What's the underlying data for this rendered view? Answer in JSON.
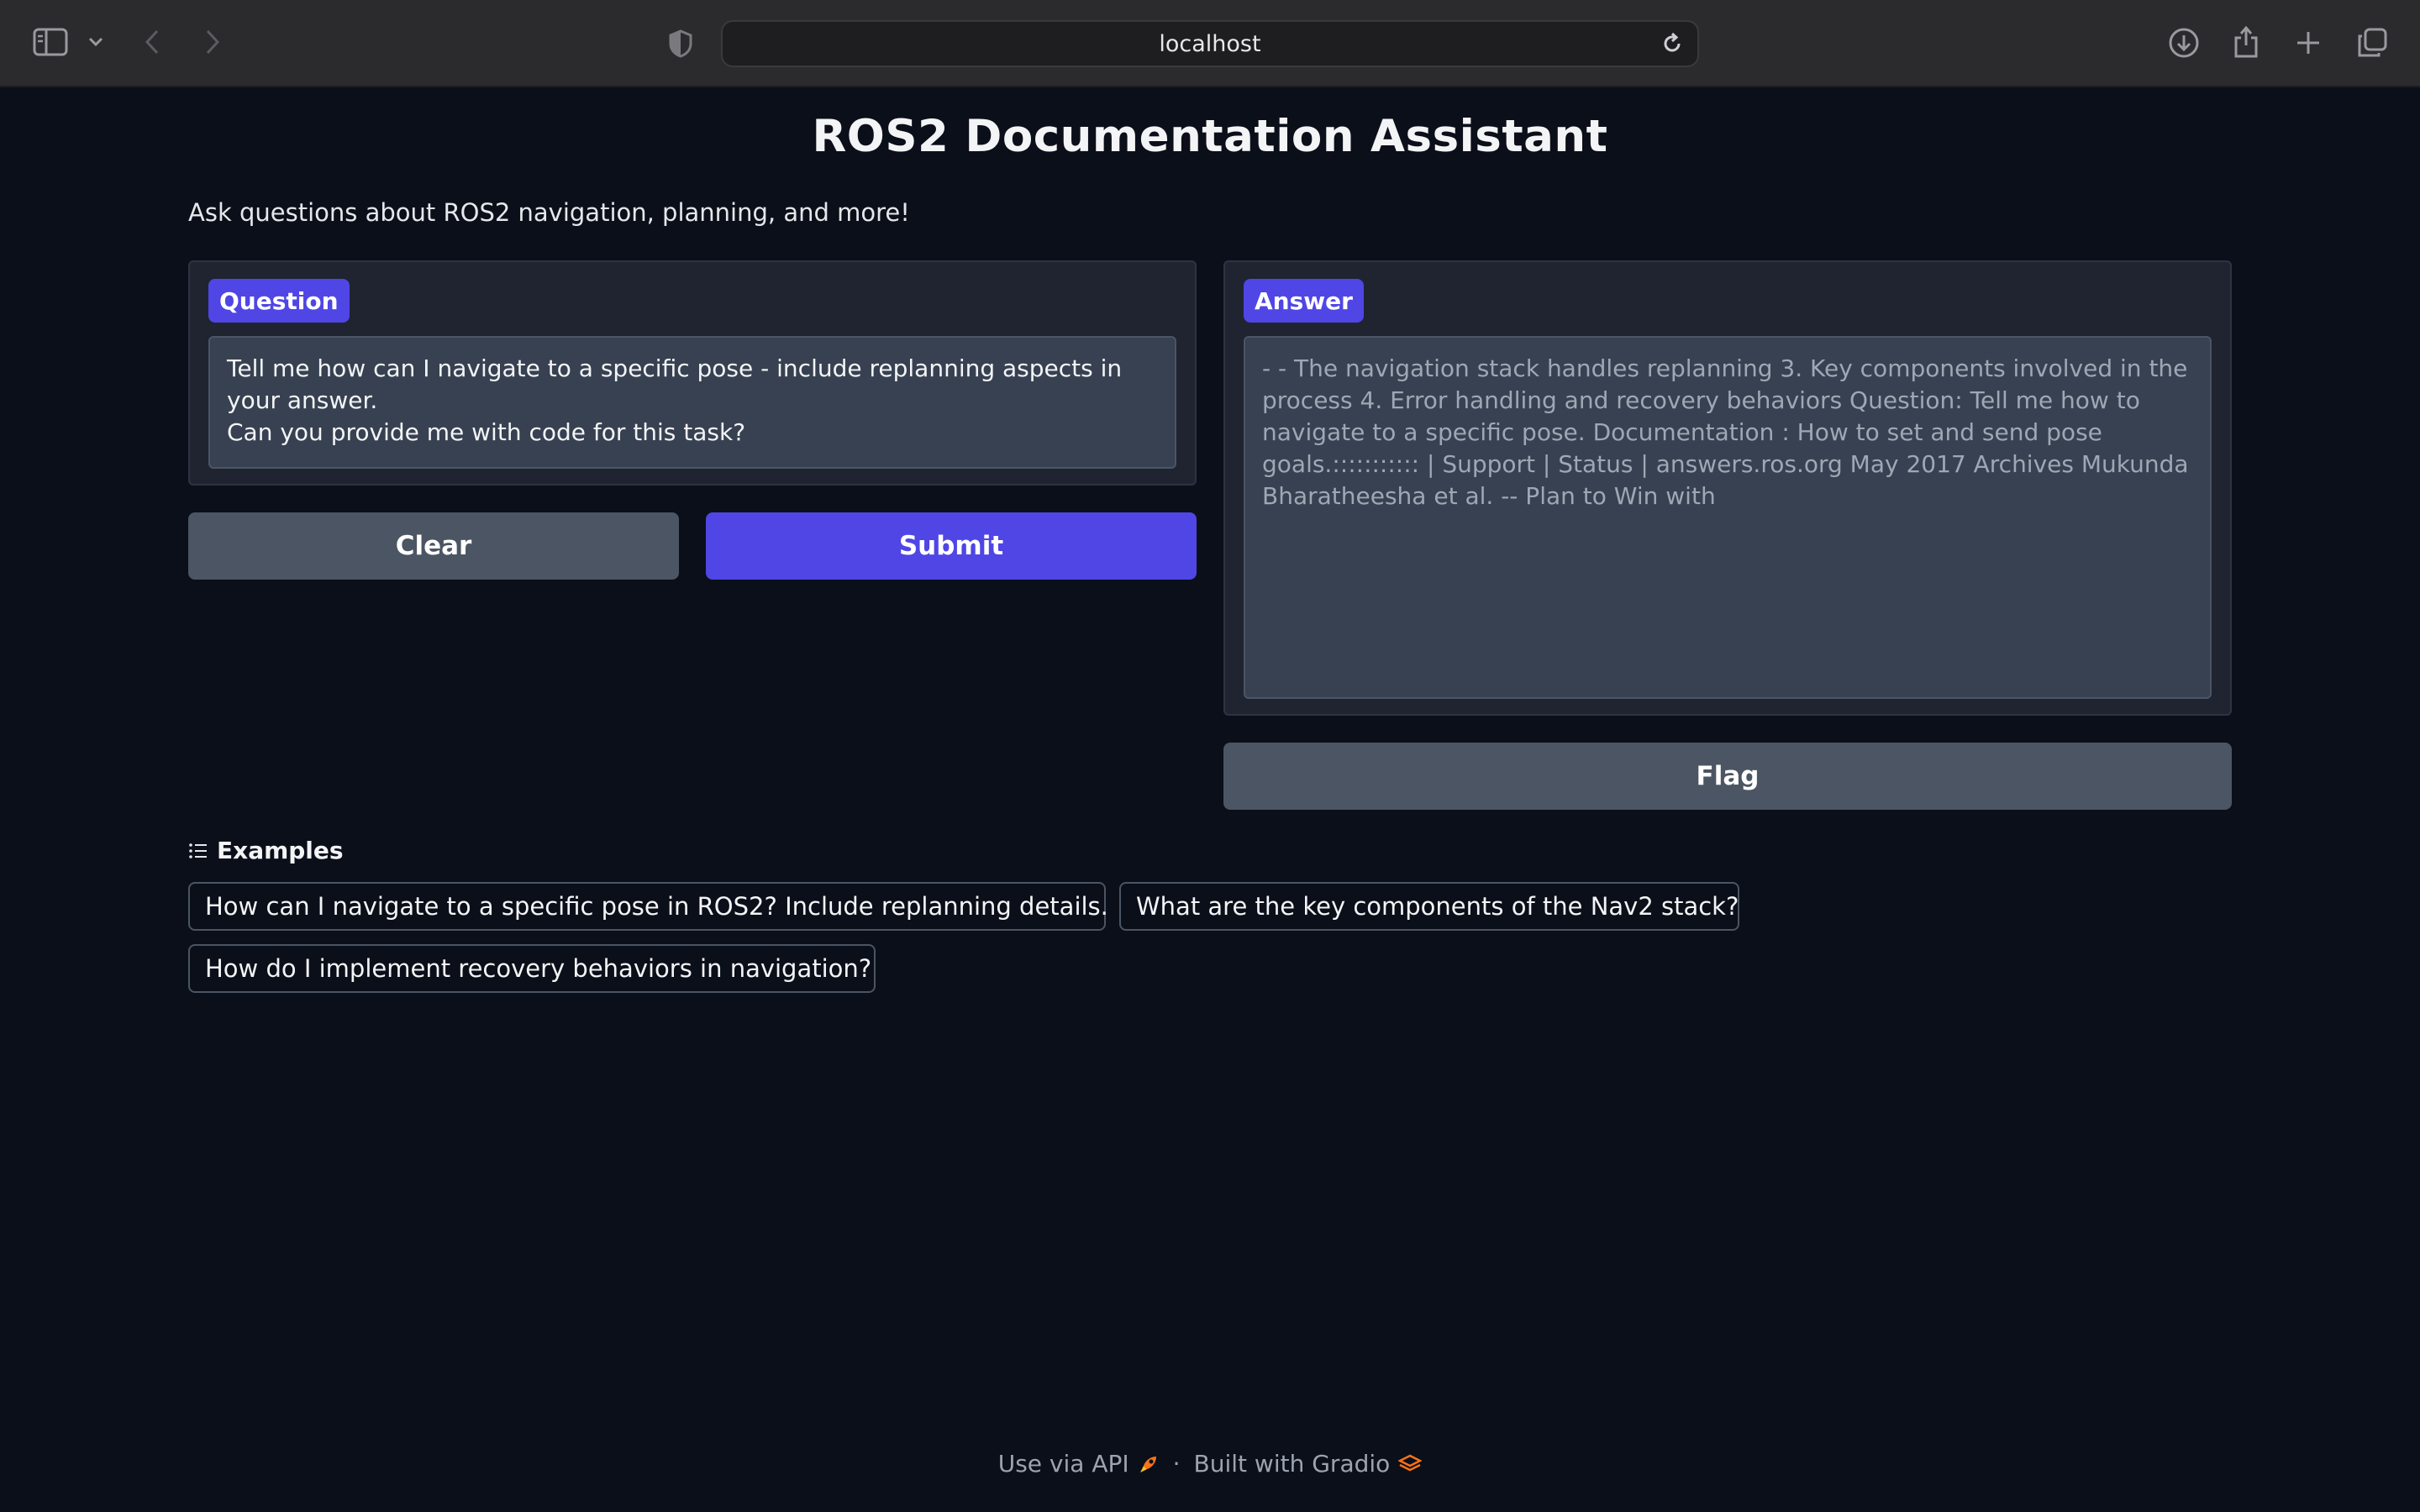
{
  "browser": {
    "url": "localhost"
  },
  "page": {
    "title": "ROS2 Documentation Assistant",
    "subtitle": "Ask questions about ROS2 navigation, planning, and more!"
  },
  "question": {
    "label": "Question",
    "value": "Tell me how can I navigate to a specific pose - include replanning aspects in your answer.\nCan you provide me with code for this task?"
  },
  "answer": {
    "label": "Answer",
    "value": "- - The navigation stack handles replanning 3. Key components involved in the process 4. Error handling and recovery behaviors Question: Tell me how to navigate to a specific pose. Documentation : How to set and send pose goals.::::::::::: | Support | Status | answers.ros.org May 2017 Archives Mukunda Bharatheesha et al. -- Plan to Win with"
  },
  "buttons": {
    "clear": "Clear",
    "submit": "Submit",
    "flag": "Flag"
  },
  "examples": {
    "label": "Examples",
    "items": [
      "How can I navigate to a specific pose in ROS2? Include replanning details.",
      "What are the key components of the Nav2 stack?",
      "How do I implement recovery behaviors in navigation?"
    ]
  },
  "footer": {
    "api_label": "Use via API",
    "separator": "·",
    "built_label": "Built with Gradio"
  },
  "colors": {
    "background": "#0b0f19",
    "primary": "#4f46e5",
    "secondary": "#4b5563"
  }
}
